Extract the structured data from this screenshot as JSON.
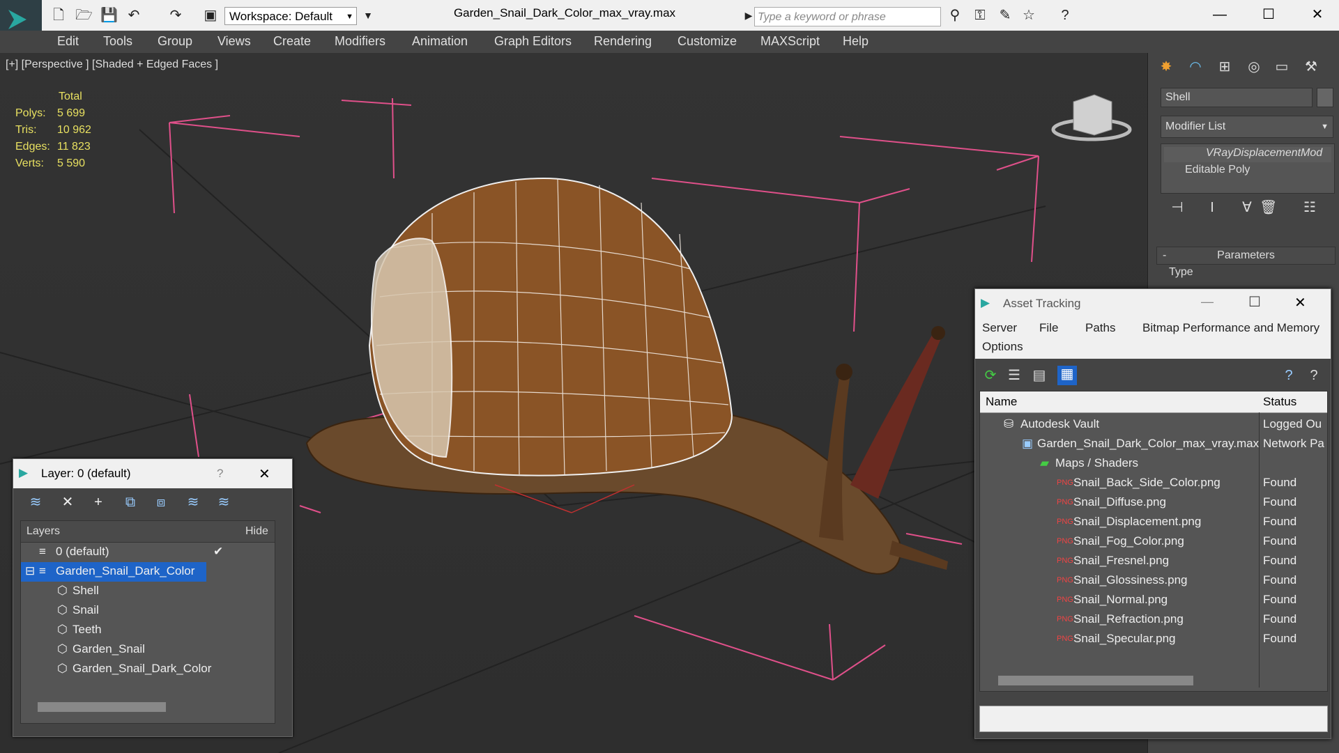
{
  "app": {
    "workspace_label": "Workspace: Default",
    "file_title": "Garden_Snail_Dark_Color_max_vray.max",
    "search_placeholder": "Type a keyword or phrase"
  },
  "menu": [
    "Edit",
    "Tools",
    "Group",
    "Views",
    "Create",
    "Modifiers",
    "Animation",
    "Graph Editors",
    "Rendering",
    "Customize",
    "MAXScript",
    "Help"
  ],
  "viewport": {
    "label": "[+] [Perspective ] [Shaded + Edged Faces ]",
    "stats": {
      "total_label": "Total",
      "rows": [
        {
          "label": "Polys:",
          "value": "5 699"
        },
        {
          "label": "Tris:",
          "value": "10 962"
        },
        {
          "label": "Edges:",
          "value": "11 823"
        },
        {
          "label": "Verts:",
          "value": "5 590"
        }
      ]
    }
  },
  "command_panel": {
    "object_name": "Shell",
    "modifier_list": "Modifier List",
    "stack": [
      "VRayDisplacementMod",
      "Editable Poly"
    ],
    "rollout_title": "Parameters",
    "type_label": "Type"
  },
  "layer_dialog": {
    "title": "Layer: 0 (default)",
    "help": "?",
    "col_layers": "Layers",
    "col_hide": "Hide",
    "rows": [
      {
        "name": "0 (default)",
        "level": 0
      },
      {
        "name": "Garden_Snail_Dark_Color",
        "level": 0
      },
      {
        "name": "Shell",
        "level": 1
      },
      {
        "name": "Snail",
        "level": 1
      },
      {
        "name": "Teeth",
        "level": 1
      },
      {
        "name": "Garden_Snail",
        "level": 1
      },
      {
        "name": "Garden_Snail_Dark_Color",
        "level": 1
      }
    ]
  },
  "asset_dialog": {
    "title": "Asset Tracking",
    "menu": [
      "Server",
      "File",
      "Paths",
      "Bitmap Performance and Memory"
    ],
    "menu2": [
      "Options"
    ],
    "col_name": "Name",
    "col_status": "Status",
    "rows": [
      {
        "name": "Autodesk Vault",
        "status": "Logged Ou",
        "level": 1
      },
      {
        "name": "Garden_Snail_Dark_Color_max_vray.max",
        "status": "Network Pa",
        "level": 2
      },
      {
        "name": "Maps / Shaders",
        "status": "",
        "level": 3
      },
      {
        "name": "Snail_Back_Side_Color.png",
        "status": "Found",
        "level": 4
      },
      {
        "name": "Snail_Diffuse.png",
        "status": "Found",
        "level": 4
      },
      {
        "name": "Snail_Displacement.png",
        "status": "Found",
        "level": 4
      },
      {
        "name": "Snail_Fog_Color.png",
        "status": "Found",
        "level": 4
      },
      {
        "name": "Snail_Fresnel.png",
        "status": "Found",
        "level": 4
      },
      {
        "name": "Snail_Glossiness.png",
        "status": "Found",
        "level": 4
      },
      {
        "name": "Snail_Normal.png",
        "status": "Found",
        "level": 4
      },
      {
        "name": "Snail_Refraction.png",
        "status": "Found",
        "level": 4
      },
      {
        "name": "Snail_Specular.png",
        "status": "Found",
        "level": 4
      }
    ]
  },
  "colors": {
    "accent": "#1e64c8",
    "stats": "#e8e060",
    "bbox": "#e0508a"
  }
}
